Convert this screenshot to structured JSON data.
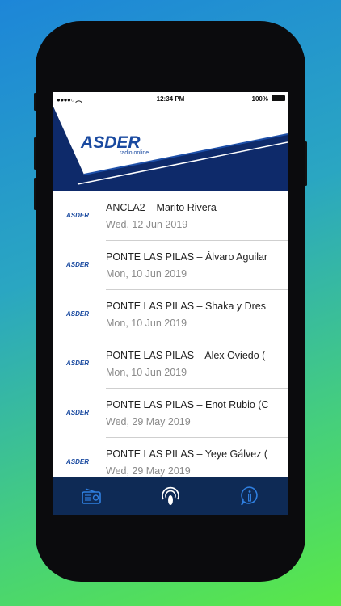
{
  "status_bar": {
    "time": "12:34 PM",
    "battery": "100%"
  },
  "brand": {
    "name": "ASDER",
    "tagline": "radio online",
    "thumb": "ASDER"
  },
  "episodes": [
    {
      "title": "ANCLA2 – Marito Rivera",
      "date": "Wed, 12 Jun 2019"
    },
    {
      "title": "PONTE LAS PILAS – Álvaro Aguilar",
      "date": "Mon, 10 Jun 2019"
    },
    {
      "title": "PONTE LAS PILAS – Shaka y Dres",
      "date": "Mon, 10 Jun 2019"
    },
    {
      "title": "PONTE LAS PILAS – Alex Oviedo (",
      "date": "Mon, 10 Jun 2019"
    },
    {
      "title": "PONTE LAS PILAS – Enot Rubio (C",
      "date": "Wed, 29 May 2019"
    },
    {
      "title": "PONTE LAS PILAS – Yeye Gálvez (",
      "date": "Wed, 29 May 2019"
    }
  ],
  "tabs": [
    {
      "icon": "radio-icon"
    },
    {
      "icon": "podcast-icon"
    },
    {
      "icon": "info-icon"
    }
  ],
  "colors": {
    "brand_blue": "#1a4aa0",
    "header_navy": "#0e2a6a",
    "tabbar": "#0e2a55"
  }
}
